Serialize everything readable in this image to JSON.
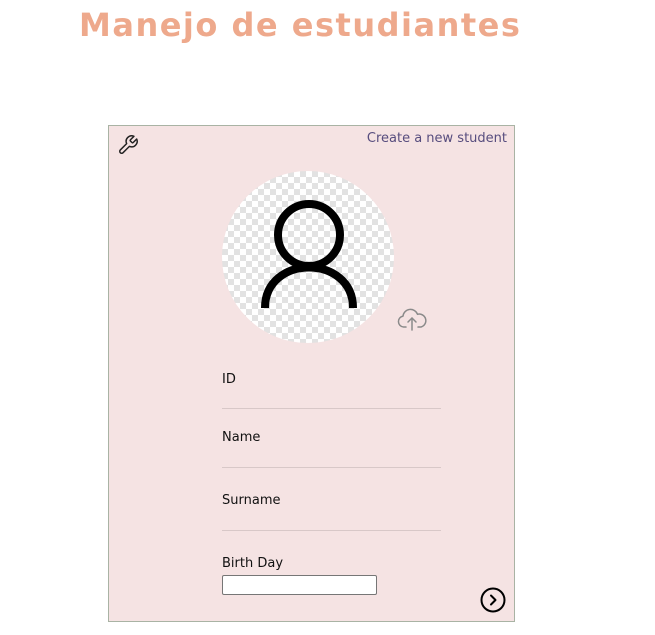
{
  "header": {
    "title": "Manejo de estudiantes"
  },
  "card": {
    "create_link": "Create a new student",
    "settings_icon": "wrench-icon",
    "avatar_icon": "user-icon",
    "upload_icon": "cloud-upload-icon",
    "next_icon": "chevron-right-circle-icon",
    "fields": {
      "id_label": "ID",
      "name_label": "Name",
      "surname_label": "Surname",
      "birthday_label": "Birth Day",
      "birthday_value": ""
    }
  },
  "colors": {
    "title": "#eea98c",
    "card_background": "#f5e3e3",
    "card_border": "#a9b3a4",
    "link": "#574d7e"
  }
}
